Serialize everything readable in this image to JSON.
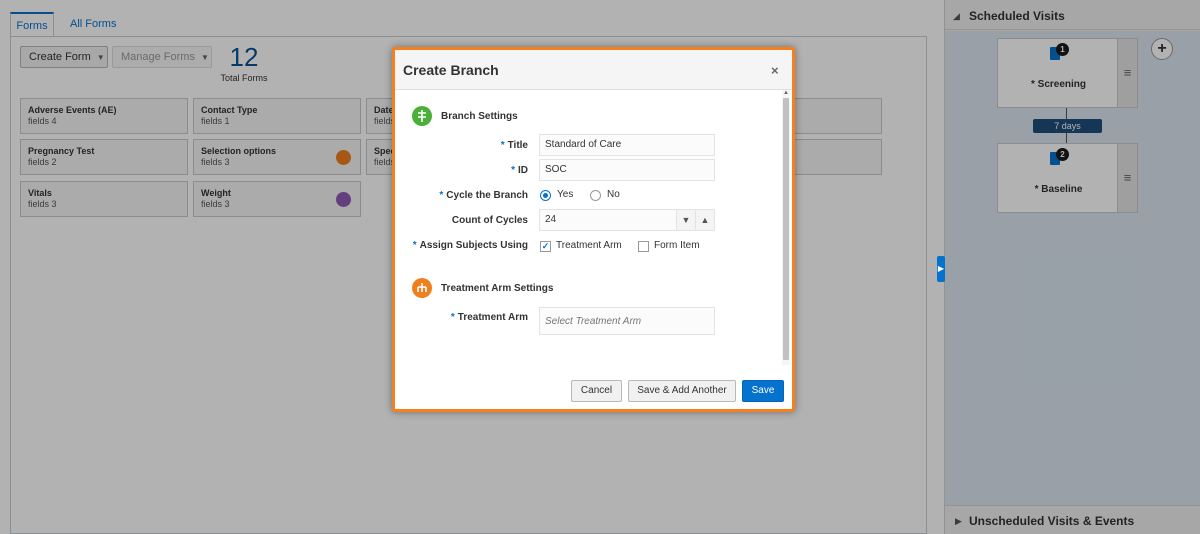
{
  "tabs": [
    "Forms",
    "All Forms"
  ],
  "toolbar": {
    "create_form": "Create Form",
    "manage_forms": "Manage Forms",
    "total_count": "12",
    "total_label": "Total Forms"
  },
  "form_cards": [
    {
      "name": "Adverse Events (AE)",
      "fields": "fields 4"
    },
    {
      "name": "Contact Type",
      "fields": "fields 1"
    },
    {
      "name": "Date",
      "fields": "fields"
    },
    {
      "name": "Pregnancy Test",
      "fields": "fields 2"
    },
    {
      "name": "Selection options",
      "fields": "fields 3"
    },
    {
      "name": "Spec",
      "fields": "fields"
    },
    {
      "name": "Vitals",
      "fields": "fields 3"
    },
    {
      "name": "Weight",
      "fields": "fields 3"
    }
  ],
  "right_panel": {
    "header": "Scheduled Visits",
    "visits": [
      {
        "name": "* Screening",
        "count": "1"
      },
      {
        "name": "* Baseline",
        "count": "2"
      }
    ],
    "interval": "7 days",
    "footer": "Unscheduled Visits & Events"
  },
  "modal": {
    "title": "Create Branch",
    "close": "×",
    "branch_section": "Branch Settings",
    "title_label": "Title",
    "title_value": "Standard of Care",
    "id_label": "ID",
    "id_value": "SOC",
    "cycle_label": "Cycle the Branch",
    "cycle_yes": "Yes",
    "cycle_no": "No",
    "count_label": "Count of Cycles",
    "count_value": "24",
    "assign_label": "Assign Subjects Using",
    "assign_opt1": "Treatment Arm",
    "assign_opt2": "Form Item",
    "arm_section": "Treatment Arm Settings",
    "arm_label": "Treatment Arm",
    "arm_placeholder": "Select Treatment Arm",
    "cancel": "Cancel",
    "save_add": "Save & Add Another",
    "save": "Save",
    "required_mark": "*"
  },
  "colors": {
    "accent": "#0572ce",
    "modal_border": "#f5801f",
    "branch_icon": "#4caf3a",
    "arm_icon": "#f07f1e"
  }
}
